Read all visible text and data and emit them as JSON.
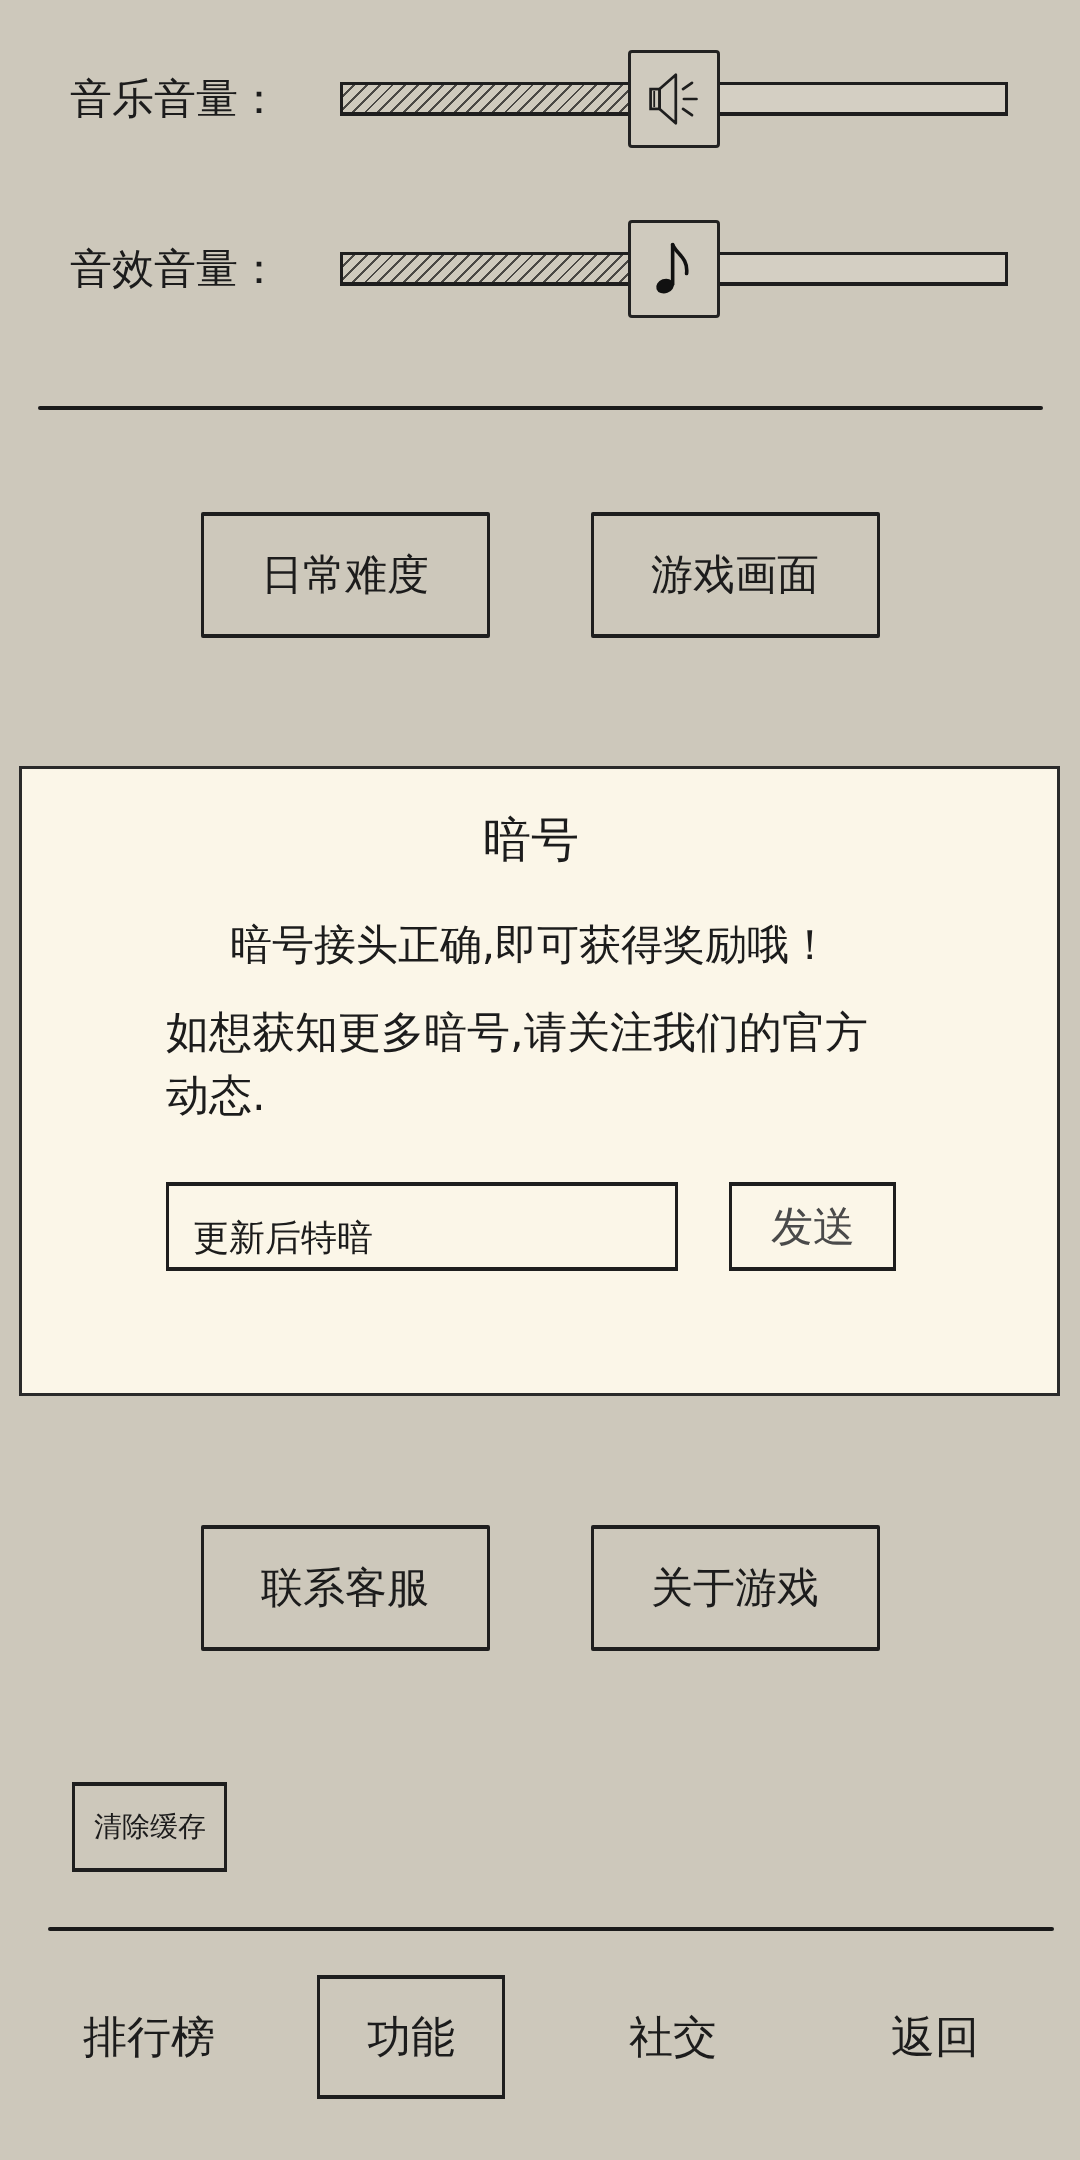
{
  "sliders": [
    {
      "label": "音乐音量：",
      "kind": "music",
      "level": 0.5
    },
    {
      "label": "音效音量：",
      "kind": "effects",
      "level": 0.5
    }
  ],
  "buttons_top": [
    "日常难度",
    "游戏画面"
  ],
  "dialog": {
    "title": "暗号",
    "message": "暗号接头正确,即可获得奖励哦！",
    "note": "如想获知更多暗号,请关注我们的官方动态.",
    "code_field": {
      "value": "更新后特暗"
    },
    "send_button": "发送"
  },
  "buttons_bottom": [
    "联系客服",
    "关于游戏"
  ],
  "clear_cache_button": "清除缓存",
  "tabs": [
    {
      "label": "排行榜",
      "selected": false
    },
    {
      "label": "功能",
      "selected": true
    },
    {
      "label": "社交",
      "selected": false
    },
    {
      "label": "返回",
      "selected": false
    }
  ]
}
